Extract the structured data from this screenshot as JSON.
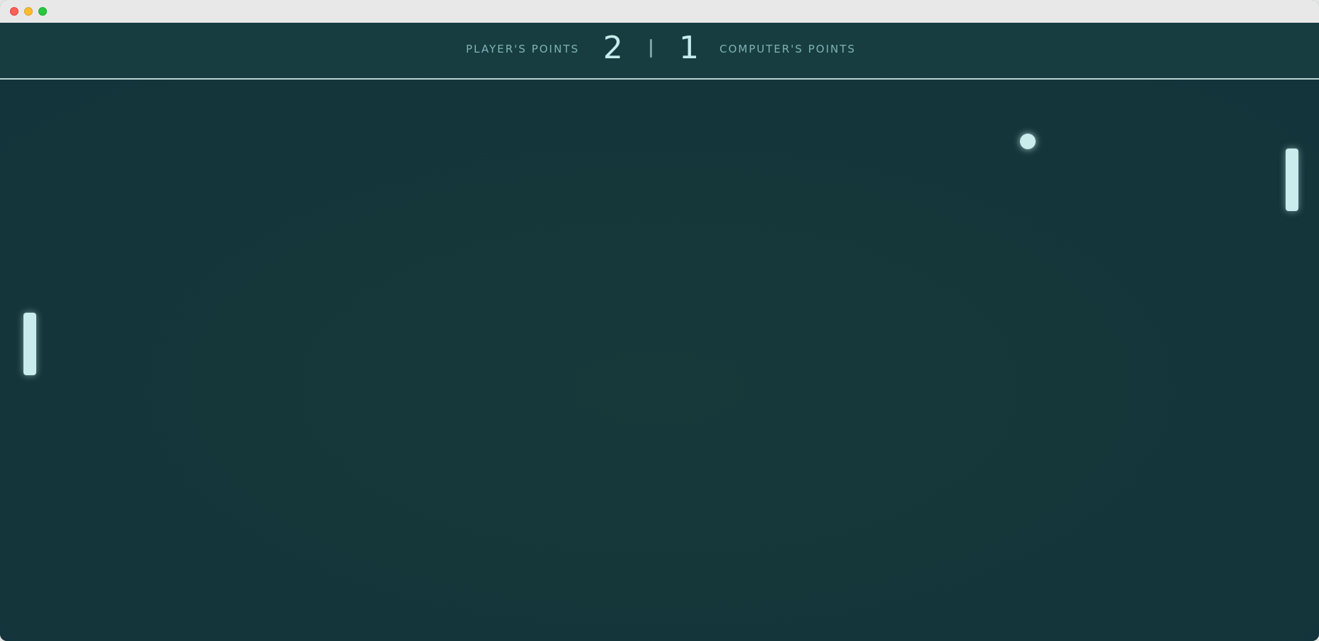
{
  "window": {
    "controls": [
      "close",
      "minimize",
      "zoom"
    ]
  },
  "scoreboard": {
    "player_label": "PLAYER'S POINTS",
    "player_score": "2",
    "divider": "|",
    "computer_score": "1",
    "computer_label": "COMPUTER'S POINTS"
  },
  "colors": {
    "background": "#16383b",
    "accent": "#c9ecec",
    "label": "#7fb3b4"
  },
  "game": {
    "entities": [
      "player-paddle",
      "computer-paddle",
      "ball"
    ]
  }
}
